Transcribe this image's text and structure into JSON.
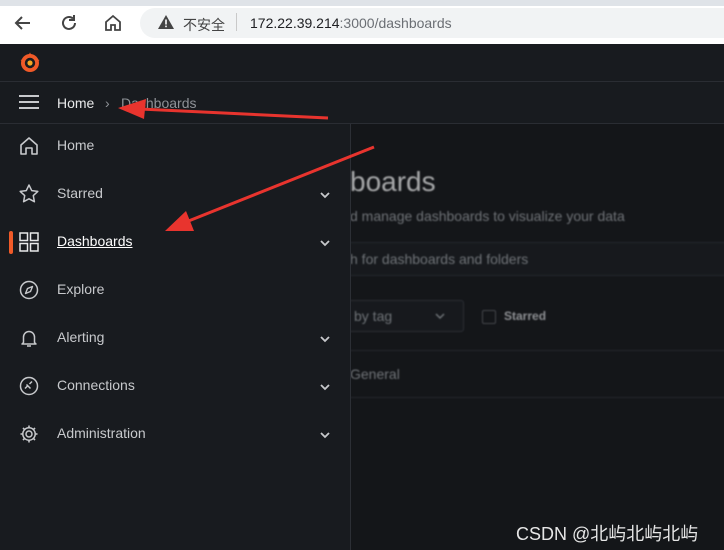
{
  "browser": {
    "security_label": "不安全",
    "url_host": "172.22.39.214",
    "url_rest": ":3000/dashboards"
  },
  "breadcrumb": {
    "home": "Home",
    "separator": "›",
    "current": "Dashboards"
  },
  "sidebar": {
    "items": [
      {
        "label": "Home",
        "icon": "home-icon"
      },
      {
        "label": "Starred",
        "icon": "star-icon",
        "expandable": true
      },
      {
        "label": "Dashboards",
        "icon": "grid-icon",
        "expandable": true,
        "active": true
      },
      {
        "label": "Explore",
        "icon": "compass-icon"
      },
      {
        "label": "Alerting",
        "icon": "bell-icon",
        "expandable": true
      },
      {
        "label": "Connections",
        "icon": "link-icon",
        "expandable": true
      },
      {
        "label": "Administration",
        "icon": "gear-icon",
        "expandable": true
      }
    ]
  },
  "main": {
    "title": "boards",
    "subtitle": "d manage dashboards to visualize your data",
    "search_placeholder": "h for dashboards and folders",
    "tag_filter": "by tag",
    "starred_label": "Starred",
    "folder": "General"
  },
  "watermark": "CSDN @北屿北屿北屿",
  "colors": {
    "accent": "#f05a28",
    "arrow": "#e8342e",
    "sidebar_bg": "#181b1f"
  }
}
